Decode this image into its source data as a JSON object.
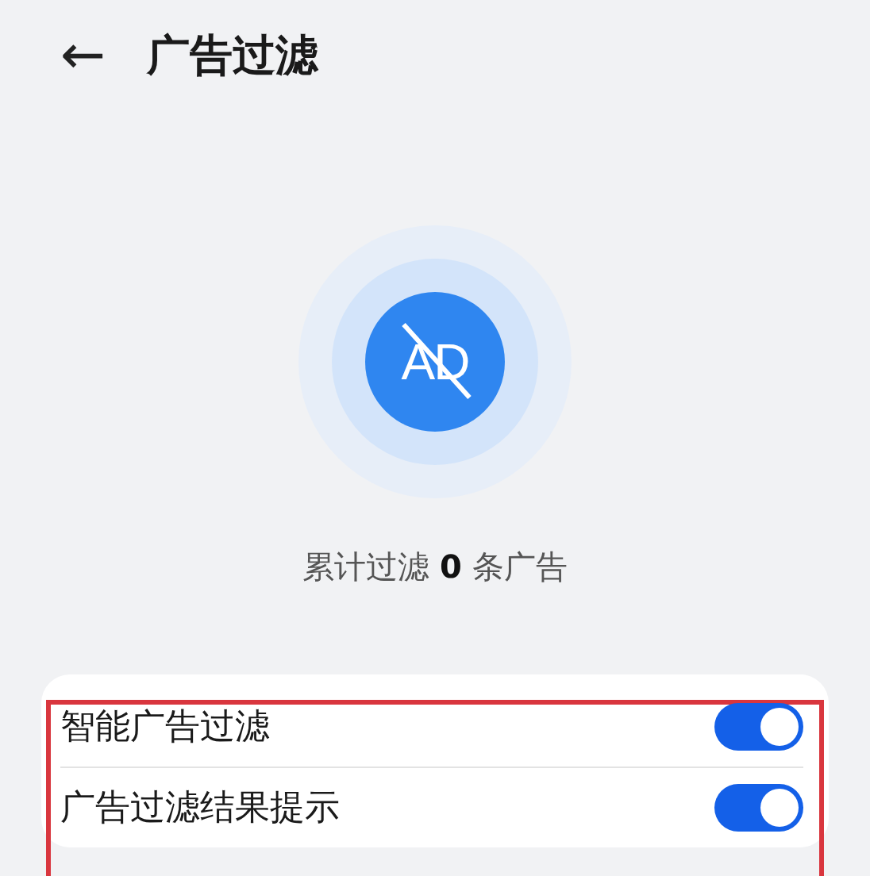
{
  "header": {
    "back_icon": "←",
    "title": "广告过滤"
  },
  "badge": {
    "icon_text": "AD"
  },
  "summary": "累计过滤 **0** 条广告",
  "settings": {
    "highlighted": true,
    "items": [
      {
        "label": "智能广告过滤",
        "on": true
      },
      {
        "label": "广告过滤结果提示",
        "on": true
      }
    ]
  }
}
